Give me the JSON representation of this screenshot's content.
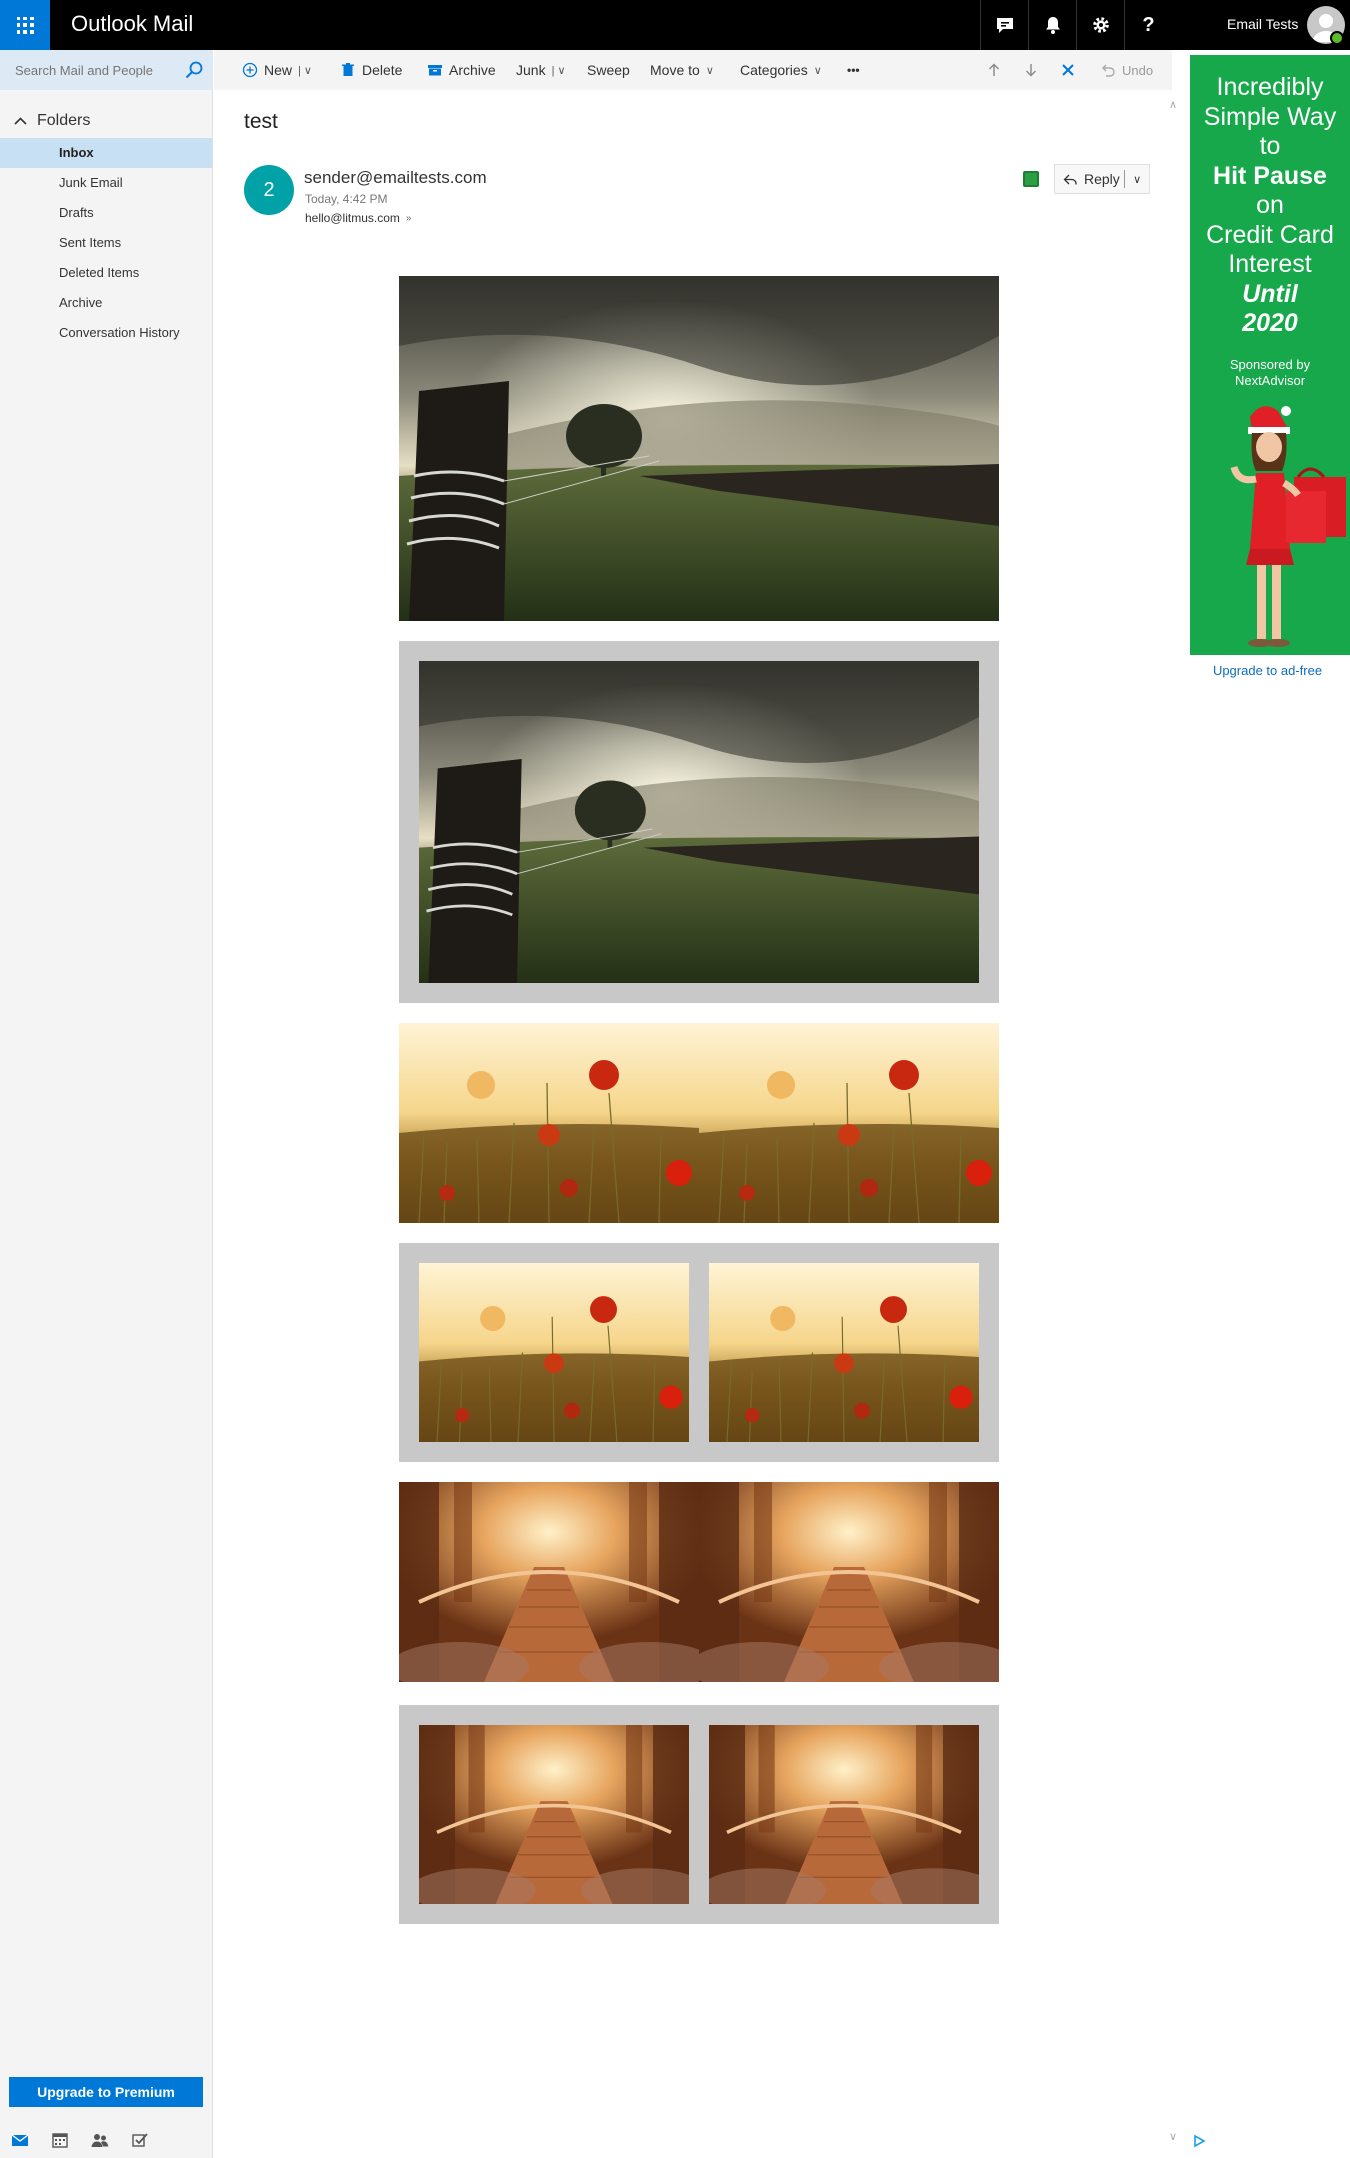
{
  "app": {
    "title": "Outlook Mail"
  },
  "topbar": {
    "icons": [
      "chat-icon",
      "bell-icon",
      "gear-icon",
      "help-icon"
    ],
    "help_label": "?",
    "user_name": "Email Tests"
  },
  "search": {
    "placeholder": "Search Mail and People"
  },
  "folders": {
    "heading": "Folders",
    "items": [
      {
        "label": "Inbox",
        "active": true
      },
      {
        "label": "Junk Email"
      },
      {
        "label": "Drafts"
      },
      {
        "label": "Sent Items"
      },
      {
        "label": "Deleted Items"
      },
      {
        "label": "Archive"
      },
      {
        "label": "Conversation History"
      }
    ]
  },
  "upgrade_button": "Upgrade to Premium",
  "commands": {
    "new": "New",
    "delete": "Delete",
    "archive": "Archive",
    "junk": "Junk",
    "sweep": "Sweep",
    "move_to": "Move to",
    "categories": "Categories",
    "more": "•••",
    "undo": "Undo"
  },
  "message": {
    "subject": "test",
    "avatar_initial": "2",
    "sender": "sender@emailtests.com",
    "time": "Today, 4:42 PM",
    "to": "hello@litmus.com",
    "reply": "Reply"
  },
  "email_images": [
    "field-fence-photo",
    "field-fence-photo-framed",
    "poppies-photo-pair",
    "poppies-photo-pair-framed",
    "bridge-photo-pair",
    "bridge-photo-pair-framed"
  ],
  "ad": {
    "line1": "Incredibly",
    "line2": "Simple Way",
    "line3": "to",
    "line4": "Hit Pause",
    "line5": "on",
    "line6": "Credit Card",
    "line7": "Interest",
    "line8": "Until",
    "line9": "2020",
    "sponsor1": "Sponsored by",
    "sponsor2": "NextAdvisor",
    "ad_free": "Upgrade to ad-free"
  },
  "colors": {
    "accent": "#0078d7",
    "topbar": "#000000",
    "ad_green": "#16a84a",
    "avatar_teal": "#00a1a7",
    "frame_gray": "#c8c8c8",
    "selected_folder": "#c7e0f4"
  }
}
